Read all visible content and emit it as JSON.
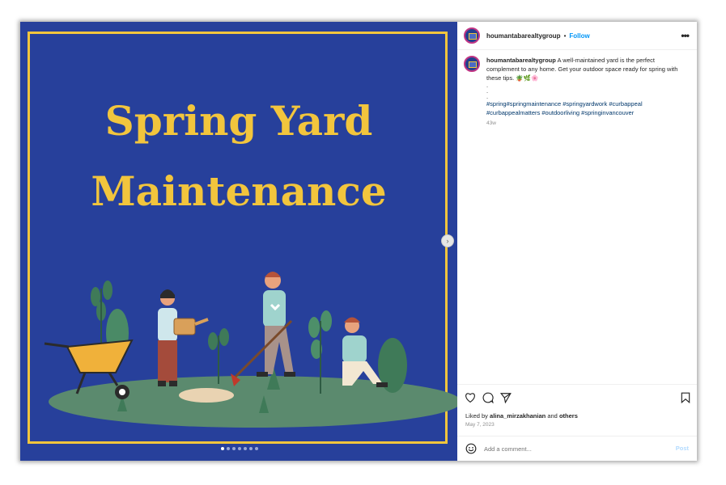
{
  "post": {
    "username": "houmantabarealtygroup",
    "header_separator": "•",
    "follow_label": "Follow",
    "more_icon": "more-horizontal-icon"
  },
  "media": {
    "headline_line1": "Spring Yard",
    "headline_line2": "Maintenance",
    "background_color": "#27409b",
    "accent_color": "#f2c53d",
    "carousel_count": 7,
    "carousel_active": 1
  },
  "caption": {
    "username": "houmantabarealtygroup",
    "text": "A well-maintained yard is the perfect complement to any home. Get your outdoor space ready for spring with these tips.",
    "emojis": "🪴🌿🌸",
    "punct_line1": ".",
    "punct_line2": ".",
    "punct_line3": ".",
    "hashtags_line1": "#spring#springmaintenance #springyardwork #curbappeal",
    "hashtags_line2": "#curbappealmatters #outdoorliving #springinvancouver",
    "age": "43w"
  },
  "actions": {
    "liked_by_prefix": "Liked by",
    "liked_by_user": "alina_mirzakhanian",
    "liked_by_and": "and",
    "liked_by_others": "others",
    "date": "May 7, 2023"
  },
  "comment": {
    "placeholder": "Add a comment...",
    "post_label": "Post"
  }
}
